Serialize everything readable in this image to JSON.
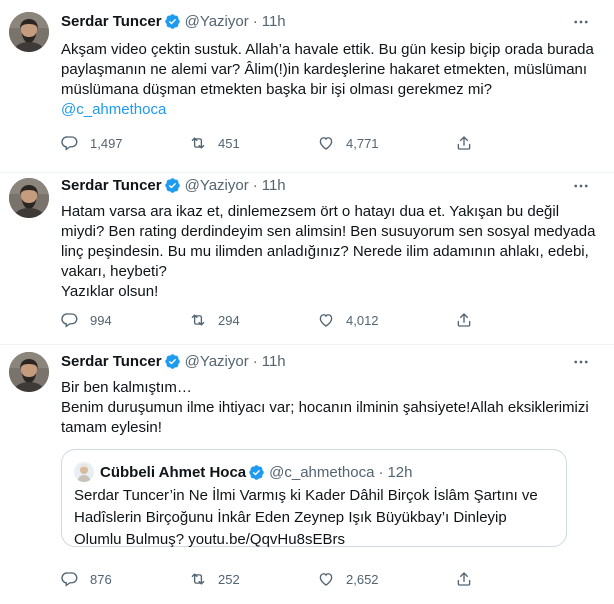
{
  "tweets": [
    {
      "name": "Serdar Tuncer",
      "handle": "@Yaziyor",
      "time": "11h",
      "text": "Akşam video çektin sustuk. Allah’a havale ettik. Bu gün kesip biçip orada burada paylaşmanın ne alemi var? Âlim(!)in kardeşlerine hakaret etmekten, müslümanı müslümana düşman etmekten başka bir işi olması gerekmez mi?",
      "mention": "@c_ahmethoca",
      "replies": "1,497",
      "retweets": "451",
      "likes": "4,771"
    },
    {
      "name": "Serdar Tuncer",
      "handle": "@Yaziyor",
      "time": "11h",
      "text": "Hatam varsa ara ikaz et, dinlemezsem ört o hatayı dua et. Yakışan bu değil miydi? Ben rating derdindeyim sen alimsin! Ben susuyorum sen sosyal medyada linç peşindesin. Bu mu ilimden anladığınız? Nerede ilim adamının ahlakı, edebi, vakarı, heybeti?\nYazıklar olsun!",
      "replies": "994",
      "retweets": "294",
      "likes": "4,012"
    },
    {
      "name": "Serdar Tuncer",
      "handle": "@Yaziyor",
      "time": "11h",
      "text": "Bir ben kalmıştım…\nBenim duruşumun ilme ihtiyacı var; hocanın ilminin şahsiyete!Allah eksiklerimizi tamam eylesin!",
      "replies": "876",
      "retweets": "252",
      "likes": "2,652",
      "quote": {
        "name": "Cübbeli Ahmet Hoca",
        "handle": "@c_ahmethoca",
        "time": "12h",
        "text": "Serdar Tuncer’in Ne İlmi Varmış ki Kader Dâhil Birçok İslâm Şartını ve Hadîslerin Birçoğunu İnkâr Eden Zeynep Işık Büyükbay’ı Dinleyip Olumlu Bulmuş? youtu.be/QqvHu8sEBrs"
      }
    }
  ],
  "separator": "·",
  "colors": {
    "accent": "#1d9bf0",
    "muted": "#536471",
    "text": "#0f1419",
    "border": "#eff3f4"
  },
  "icons": [
    "verified-badge-icon",
    "more-icon",
    "reply-icon",
    "retweet-icon",
    "like-icon",
    "share-icon"
  ]
}
